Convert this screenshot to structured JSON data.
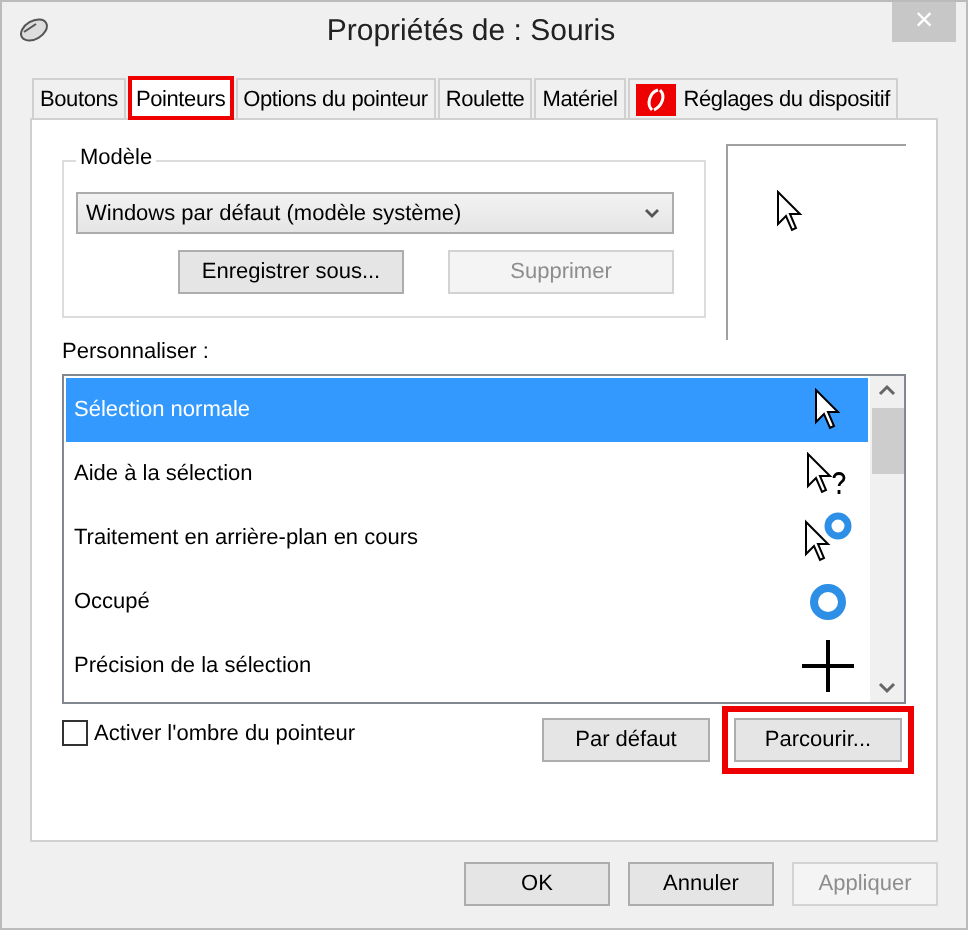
{
  "window": {
    "title": "Propriétés de : Souris",
    "close": "×"
  },
  "tabs": [
    {
      "label": "Boutons",
      "selected": false,
      "highlighted": false
    },
    {
      "label": "Pointeurs",
      "selected": true,
      "highlighted": true
    },
    {
      "label": "Options du pointeur",
      "selected": false,
      "highlighted": false
    },
    {
      "label": "Roulette",
      "selected": false,
      "highlighted": false
    },
    {
      "label": "Matériel",
      "selected": false,
      "highlighted": false
    },
    {
      "label": "Réglages du dispositif",
      "selected": false,
      "highlighted": false,
      "kind": "logo"
    }
  ],
  "scheme": {
    "legend": "Modèle",
    "value": "Windows par défaut (modèle système)",
    "buttons": [
      {
        "label": "Enregistrer sous...",
        "disabled": false
      },
      {
        "label": "Supprimer",
        "disabled": true
      }
    ]
  },
  "customize": {
    "label": "Personnaliser :",
    "items": [
      {
        "label": "Sélection normale",
        "selected": true,
        "kind": "arrow"
      },
      {
        "label": "Aide à la sélection",
        "selected": false,
        "kind": "help"
      },
      {
        "label": "Traitement en arrière-plan en cours",
        "selected": false,
        "kind": "working"
      },
      {
        "label": "Occupé",
        "selected": false,
        "kind": "busy"
      },
      {
        "label": "Précision de la sélection",
        "selected": false,
        "kind": "cross"
      }
    ]
  },
  "shadow": {
    "label": "Activer l'ombre du pointeur",
    "checked": false
  },
  "list_buttons": [
    {
      "label": "Par défaut",
      "highlighted": false
    },
    {
      "label": "Parcourir...",
      "highlighted": true
    }
  ],
  "dialog_buttons": [
    {
      "label": "OK",
      "disabled": false
    },
    {
      "label": "Annuler",
      "disabled": false
    },
    {
      "label": "Appliquer",
      "disabled": true
    }
  ]
}
